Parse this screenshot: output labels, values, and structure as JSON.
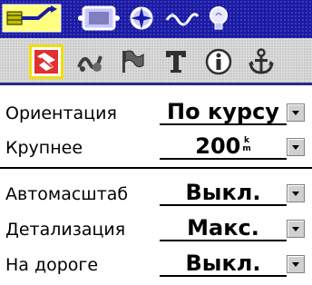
{
  "top_tabs": [
    {
      "icon": "route-arrow-icon",
      "selected": true
    },
    {
      "icon": "screen-display-icon",
      "selected": false
    },
    {
      "icon": "compass-rose-icon",
      "selected": false
    },
    {
      "icon": "wave-signal-icon",
      "selected": false
    },
    {
      "icon": "light-bulb-icon",
      "selected": false
    }
  ],
  "icon_bar": [
    {
      "icon": "map-setup-icon",
      "selected": true
    },
    {
      "icon": "track-icon",
      "selected": false
    },
    {
      "icon": "waypoint-flag-icon",
      "selected": false
    },
    {
      "icon": "text-icon",
      "selected": false
    },
    {
      "icon": "info-icon",
      "selected": false
    },
    {
      "icon": "anchor-icon",
      "selected": false
    }
  ],
  "settings": {
    "orientation": {
      "label": "Ориентация",
      "value": "По курсу"
    },
    "larger": {
      "label": "Крупнее",
      "value": "200",
      "unit_top": "k",
      "unit_bottom": "m"
    },
    "automatic_zoom": {
      "label": "Автомасштаб",
      "value": "Выкл."
    },
    "detail": {
      "label": "Детализация",
      "value": "Макс."
    },
    "on_road": {
      "label": "На дороге",
      "value": "Выкл."
    }
  },
  "colors": {
    "top_bar": "#1a1aa6",
    "icon_bar": "#c9c9c9",
    "selection": "#f0e000"
  }
}
